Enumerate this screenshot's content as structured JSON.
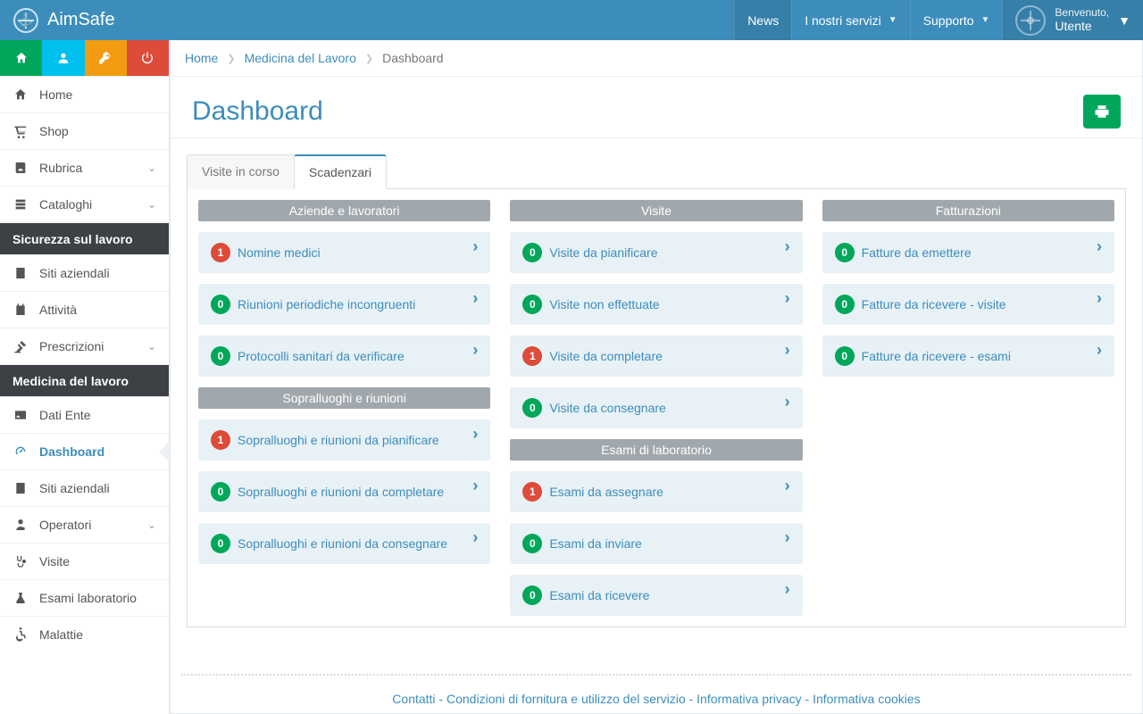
{
  "brand": "AimSafe",
  "header": {
    "nav": [
      {
        "label": "News"
      },
      {
        "label": "I nostri servizi",
        "caret": true
      },
      {
        "label": "Supporto",
        "caret": true
      }
    ],
    "user": {
      "welcome": "Benvenuto,",
      "name": "Utente"
    }
  },
  "sidebar": {
    "items": [
      {
        "icon": "home",
        "label": "Home"
      },
      {
        "icon": "cart",
        "label": "Shop"
      },
      {
        "icon": "book-user",
        "label": "Rubrica",
        "chev": true
      },
      {
        "icon": "catalog",
        "label": "Cataloghi",
        "chev": true
      },
      {
        "section": true,
        "label": "Sicurezza sul lavoro"
      },
      {
        "icon": "building",
        "label": "Siti aziendali"
      },
      {
        "icon": "calendar",
        "label": "Attività"
      },
      {
        "icon": "gavel",
        "label": "Prescrizioni",
        "chev": true
      },
      {
        "section": true,
        "label": "Medicina del lavoro"
      },
      {
        "icon": "id-card",
        "label": "Dati Ente"
      },
      {
        "icon": "dashboard",
        "label": "Dashboard",
        "active": true
      },
      {
        "icon": "building",
        "label": "Siti aziendali"
      },
      {
        "icon": "user-md",
        "label": "Operatori",
        "chev": true
      },
      {
        "icon": "stethoscope",
        "label": "Visite"
      },
      {
        "icon": "flask",
        "label": "Esami laboratorio"
      },
      {
        "icon": "wheelchair",
        "label": "Malattie"
      }
    ]
  },
  "breadcrumb": {
    "home": "Home",
    "section": "Medicina del Lavoro",
    "current": "Dashboard"
  },
  "page": {
    "title": "Dashboard"
  },
  "tabs": {
    "inactive": "Visite in corso",
    "active": "Scadenzari"
  },
  "columns": [
    {
      "title": "Aziende e lavoratori",
      "cards": [
        {
          "count": 1,
          "color": "red",
          "label": "Nomine medici"
        },
        {
          "count": 0,
          "color": "green",
          "label": "Riunioni periodiche incongruenti"
        },
        {
          "count": 0,
          "color": "green",
          "label": "Protocolli sanitari da verificare"
        }
      ],
      "secondTitle": "Sopralluoghi e riunioni",
      "cards2": [
        {
          "count": 1,
          "color": "red",
          "label": "Sopralluoghi e riunioni da pianificare"
        },
        {
          "count": 0,
          "color": "green",
          "label": "Sopralluoghi e riunioni da completare"
        },
        {
          "count": 0,
          "color": "green",
          "label": "Sopralluoghi e riunioni da consegnare"
        }
      ]
    },
    {
      "title": "Visite",
      "cards": [
        {
          "count": 0,
          "color": "green",
          "label": "Visite da pianificare"
        },
        {
          "count": 0,
          "color": "green",
          "label": "Visite non effettuate"
        },
        {
          "count": 1,
          "color": "red",
          "label": "Visite da completare"
        },
        {
          "count": 0,
          "color": "green",
          "label": "Visite da consegnare"
        }
      ],
      "secondTitle": "Esami di laboratorio",
      "cards2": [
        {
          "count": 1,
          "color": "red",
          "label": "Esami da assegnare"
        },
        {
          "count": 0,
          "color": "green",
          "label": "Esami da inviare"
        },
        {
          "count": 0,
          "color": "green",
          "label": "Esami da ricevere"
        }
      ]
    },
    {
      "title": "Fatturazioni",
      "cards": [
        {
          "count": 0,
          "color": "green",
          "label": "Fatture da emettere"
        },
        {
          "count": 0,
          "color": "green",
          "label": "Fatture da ricevere - visite"
        },
        {
          "count": 0,
          "color": "green",
          "label": "Fatture da ricevere - esami"
        }
      ]
    }
  ],
  "footer": {
    "links": [
      "Contatti",
      "Condizioni di fornitura e utilizzo del servizio",
      "Informativa privacy",
      "Informativa cookies"
    ],
    "sep": " - "
  }
}
